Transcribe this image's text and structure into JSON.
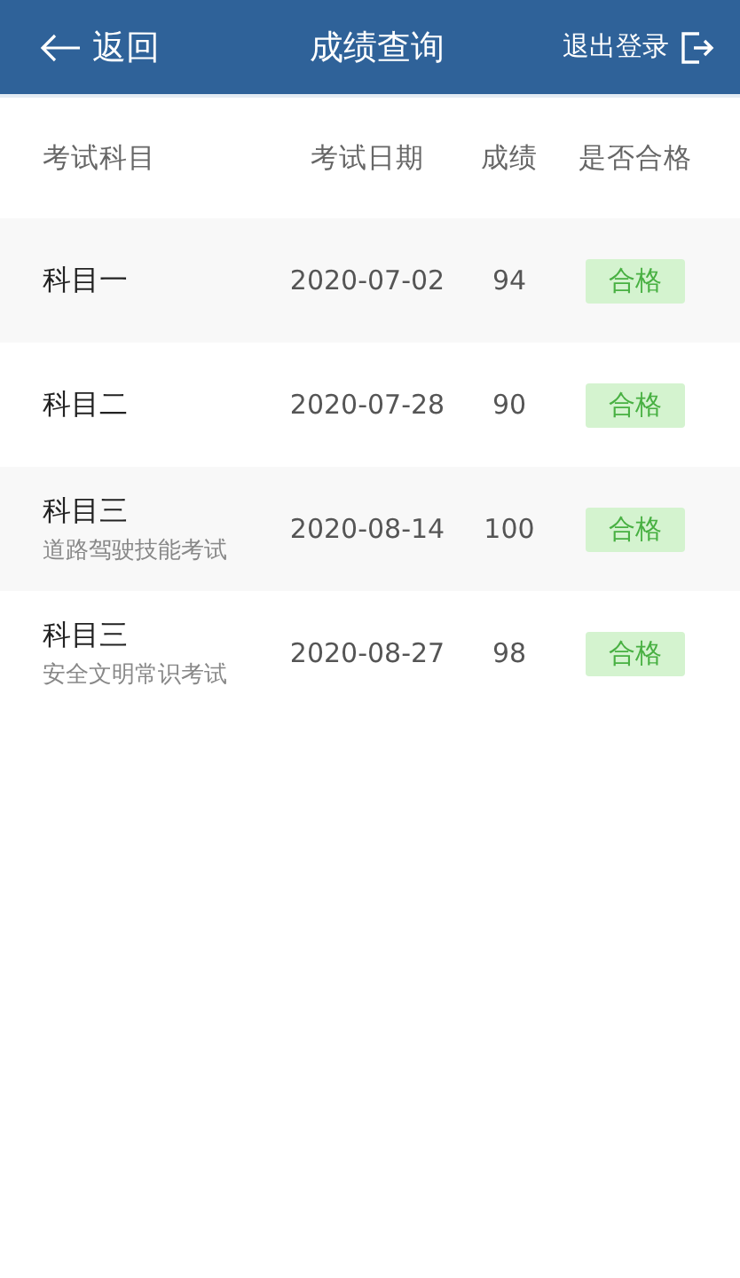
{
  "header": {
    "back_label": "返回",
    "title": "成绩查询",
    "logout_label": "退出登录"
  },
  "table": {
    "columns": [
      "考试科目",
      "考试日期",
      "成绩",
      "是否合格"
    ],
    "rows": [
      {
        "subject": "科目一",
        "date": "2020-07-02",
        "score": "94",
        "result": "合格",
        "passed": true
      },
      {
        "subject": "科目二",
        "date": "2020-07-28",
        "score": "90",
        "result": "合格",
        "passed": true
      },
      {
        "subject": "科目三",
        "subtitle": "道路驾驶技能考试",
        "date": "2020-08-14",
        "score": "100",
        "result": "合格",
        "passed": true
      },
      {
        "subject": "科目三",
        "subtitle": "安全文明常识考试",
        "date": "2020-08-27",
        "score": "98",
        "result": "合格",
        "passed": true
      }
    ]
  }
}
